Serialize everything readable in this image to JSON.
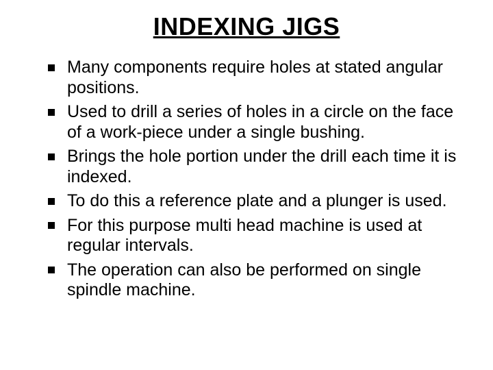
{
  "title": "INDEXING JIGS",
  "bullets": [
    "Many components require holes at stated angular positions.",
    "Used to drill a series of holes in a circle on the face of a work-piece under a single bushing.",
    "Brings the hole portion under the drill each time it is indexed.",
    "To do this a reference plate and a plunger is used.",
    "For this purpose multi head machine is used at regular intervals.",
    "The operation can also be performed on single spindle machine."
  ]
}
